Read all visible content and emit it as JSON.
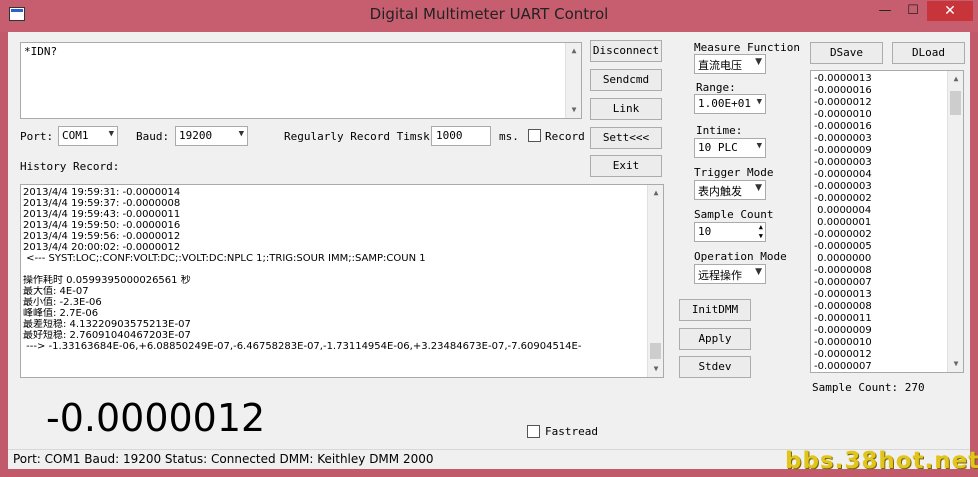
{
  "window": {
    "title": "Digital Multimeter UART Control",
    "minimize_glyph": "—",
    "maximize_glyph": "☐",
    "close_glyph": "✕"
  },
  "command_input": {
    "value": "*IDN?"
  },
  "buttons": {
    "disconnect": "Disconnect",
    "sendcmd": "Sendcmd",
    "link": "Link",
    "sett": "Sett<<<",
    "exit": "Exit",
    "initdmm": "InitDMM",
    "apply": "Apply",
    "stdev": "Stdev",
    "dsave": "DSave",
    "dload": "DLoad"
  },
  "connection": {
    "port_label": "Port:",
    "port_value": "COM1",
    "baud_label": "Baud:",
    "baud_value": "19200",
    "timsk_label": "Regularly Record Timsk:",
    "timsk_value": "1000",
    "timsk_unit": "ms.",
    "record_label": "Record",
    "record_checked": false
  },
  "history": {
    "label": "History Record:",
    "lines": [
      "2013/4/4 19:59:31: -0.0000014",
      "2013/4/4 19:59:37: -0.0000008",
      "2013/4/4 19:59:43: -0.0000011",
      "2013/4/4 19:59:50: -0.0000016",
      "2013/4/4 19:59:56: -0.0000012",
      "2013/4/4 20:00:02: -0.0000012",
      " <--- SYST:LOC;:CONF:VOLT:DC;:VOLT:DC:NPLC 1;:TRIG:SOUR IMM;:SAMP:COUN 1",
      "",
      "操作耗时 0.0599395000026561 秒",
      "最大值: 4E-07",
      "最小值: -2.3E-06",
      "峰峰值: 2.7E-06",
      "最差短稳: 4.13220903575213E-07",
      "最好短稳: 2.76091040467203E-07",
      " ---> -1.33163684E-06,+6.08850249E-07,-6.46758283E-07,-1.73114954E-06,+3.23484673E-07,-7.60904514E-"
    ]
  },
  "settings": {
    "measure_function_label": "Measure Function",
    "measure_function_value": "直流电压",
    "range_label": "Range:",
    "range_value": "1.00E+01",
    "intime_label": "Intime:",
    "intime_value": "10 PLC",
    "trigger_mode_label": "Trigger Mode",
    "trigger_mode_value": "表内触发",
    "sample_count_label": "Sample Count",
    "sample_count_value": "10",
    "operation_mode_label": "Operation Mode",
    "operation_mode_value": "远程操作"
  },
  "samples": {
    "values": [
      "-0.0000013",
      "-0.0000016",
      "-0.0000012",
      "-0.0000010",
      "-0.0000016",
      "-0.0000003",
      "-0.0000009",
      "-0.0000003",
      "-0.0000004",
      "-0.0000003",
      "-0.0000002",
      " 0.0000004",
      " 0.0000001",
      "-0.0000002",
      "-0.0000005",
      " 0.0000000",
      "-0.0000008",
      "-0.0000007",
      "-0.0000013",
      "-0.0000008",
      "-0.0000011",
      "-0.0000009",
      "-0.0000010",
      "-0.0000012",
      "-0.0000007"
    ],
    "count_label": "Sample Count:",
    "count_value": "270"
  },
  "reading": {
    "value": "-0.0000012"
  },
  "fastread": {
    "label": "Fastread",
    "checked": false
  },
  "statusbar": {
    "text": "Port: COM1  Baud: 19200  Status: Connected  DMM: Keithley DMM 2000"
  },
  "watermark": {
    "text": "bbs.38hot.net"
  },
  "icons": {
    "combo_arrow": "▼",
    "spin_up": "▲",
    "spin_down": "▼",
    "scroll_up": "▲",
    "scroll_down": "▼"
  }
}
